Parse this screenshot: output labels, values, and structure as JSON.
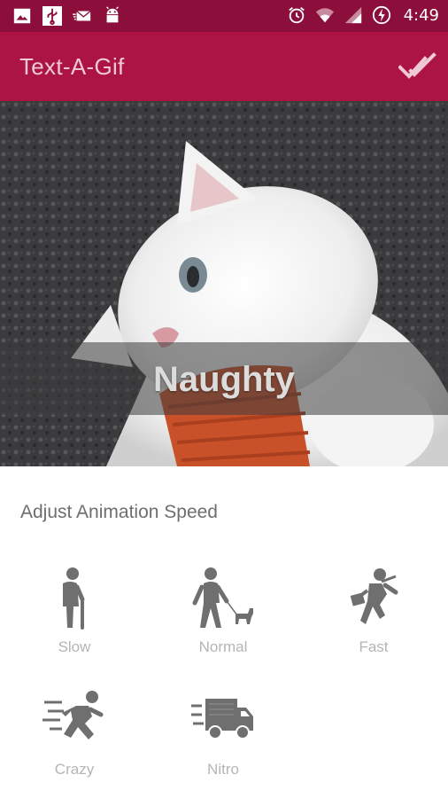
{
  "status_bar": {
    "left_icons": [
      "image-icon",
      "usb-icon",
      "mail-icon",
      "android-icon"
    ],
    "right_icons": [
      "alarm-icon",
      "wifi-icon",
      "signal-icon",
      "battery-charging-icon"
    ],
    "time": "4:49"
  },
  "app_bar": {
    "title": "Text-A-Gif",
    "action_icon": "done-all-icon"
  },
  "preview": {
    "caption": "Naughty"
  },
  "speed": {
    "title": "Adjust Animation Speed",
    "options": [
      {
        "label": "Slow",
        "icon": "elderly-person-icon"
      },
      {
        "label": "Normal",
        "icon": "person-walking-dog-icon"
      },
      {
        "label": "Fast",
        "icon": "running-businessman-icon"
      },
      {
        "label": "Crazy",
        "icon": "sprinting-person-icon"
      },
      {
        "label": "Nitro",
        "icon": "fast-truck-icon"
      }
    ]
  },
  "colors": {
    "status_bar": "#8c0f3b",
    "app_bar": "#ab1443",
    "icon_gray": "#6f6f6f",
    "label_gray": "#b5b5b5"
  }
}
